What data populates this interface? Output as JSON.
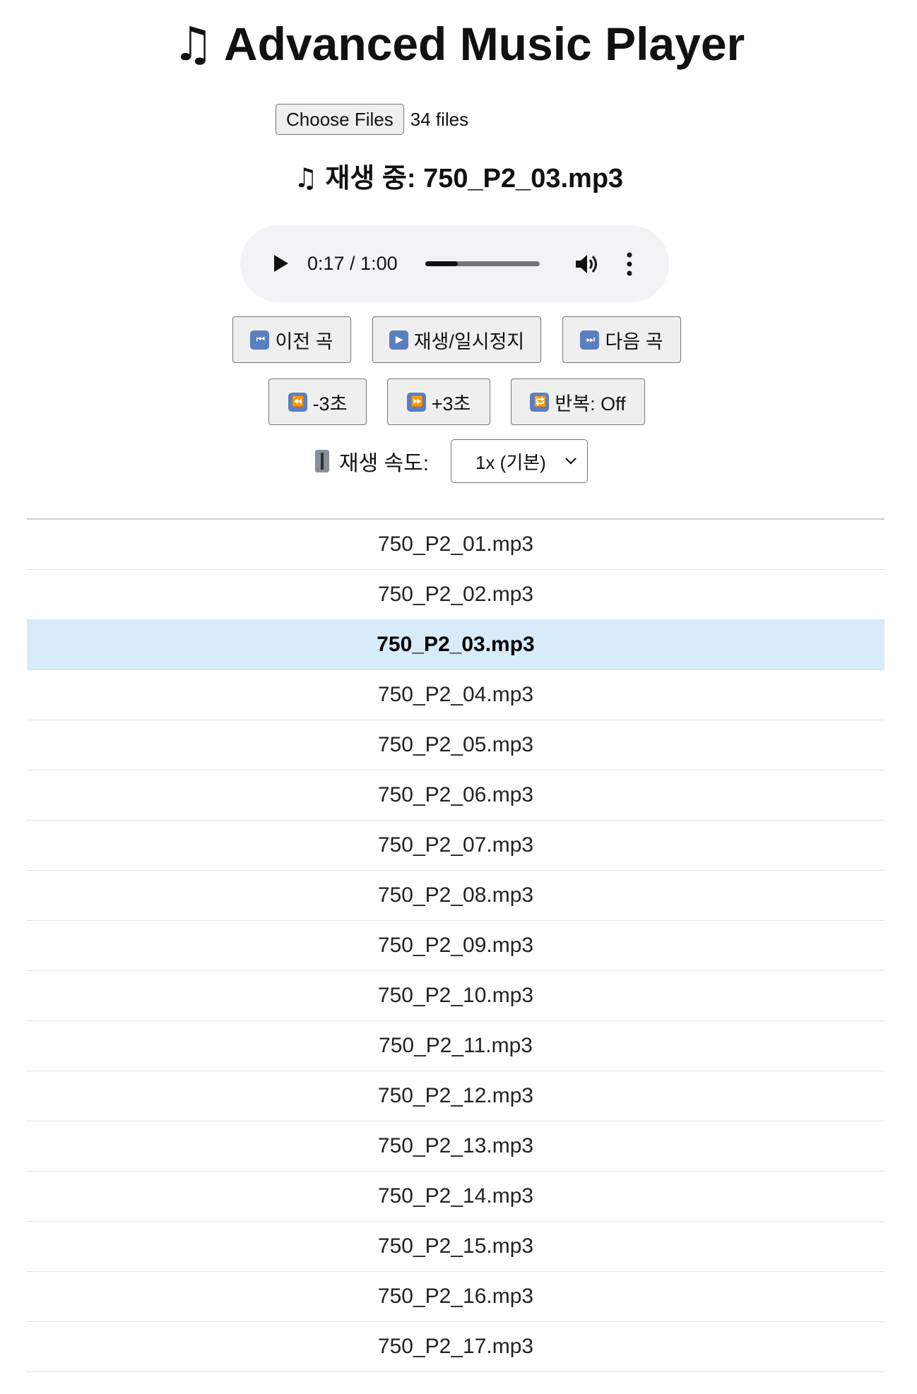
{
  "header": {
    "title": "Advanced Music Player",
    "title_icon": "musical-notes-icon"
  },
  "file_input": {
    "button_label": "Choose Files",
    "count_text": "34 files"
  },
  "now_playing": {
    "text": "재생 중: 750_P2_03.mp3",
    "icon": "musical-notes-icon"
  },
  "audio_player": {
    "time_text": "0:17 / 1:00",
    "progress": 0.283,
    "icons": [
      "play-icon",
      "volume-icon",
      "more-options-icon"
    ]
  },
  "controls": {
    "prev_label": "이전 곡",
    "play_pause_label": "재생/일시정지",
    "next_label": "다음 곡",
    "back3_label": "-3초",
    "fwd3_label": "+3초",
    "repeat_label": "반복: Off"
  },
  "speed": {
    "label": "재생 속도:",
    "selected": "1x (기본)",
    "icon": "speed-control-icon"
  },
  "playlist": {
    "active_index": 2,
    "items": [
      "750_P2_01.mp3",
      "750_P2_02.mp3",
      "750_P2_03.mp3",
      "750_P2_04.mp3",
      "750_P2_05.mp3",
      "750_P2_06.mp3",
      "750_P2_07.mp3",
      "750_P2_08.mp3",
      "750_P2_09.mp3",
      "750_P2_10.mp3",
      "750_P2_11.mp3",
      "750_P2_12.mp3",
      "750_P2_13.mp3",
      "750_P2_14.mp3",
      "750_P2_15.mp3",
      "750_P2_16.mp3",
      "750_P2_17.mp3"
    ]
  },
  "colors": {
    "active_row": "#d8ebf9",
    "player_bg": "#f1f3f4",
    "emoji_button": "#5a7fbf"
  }
}
